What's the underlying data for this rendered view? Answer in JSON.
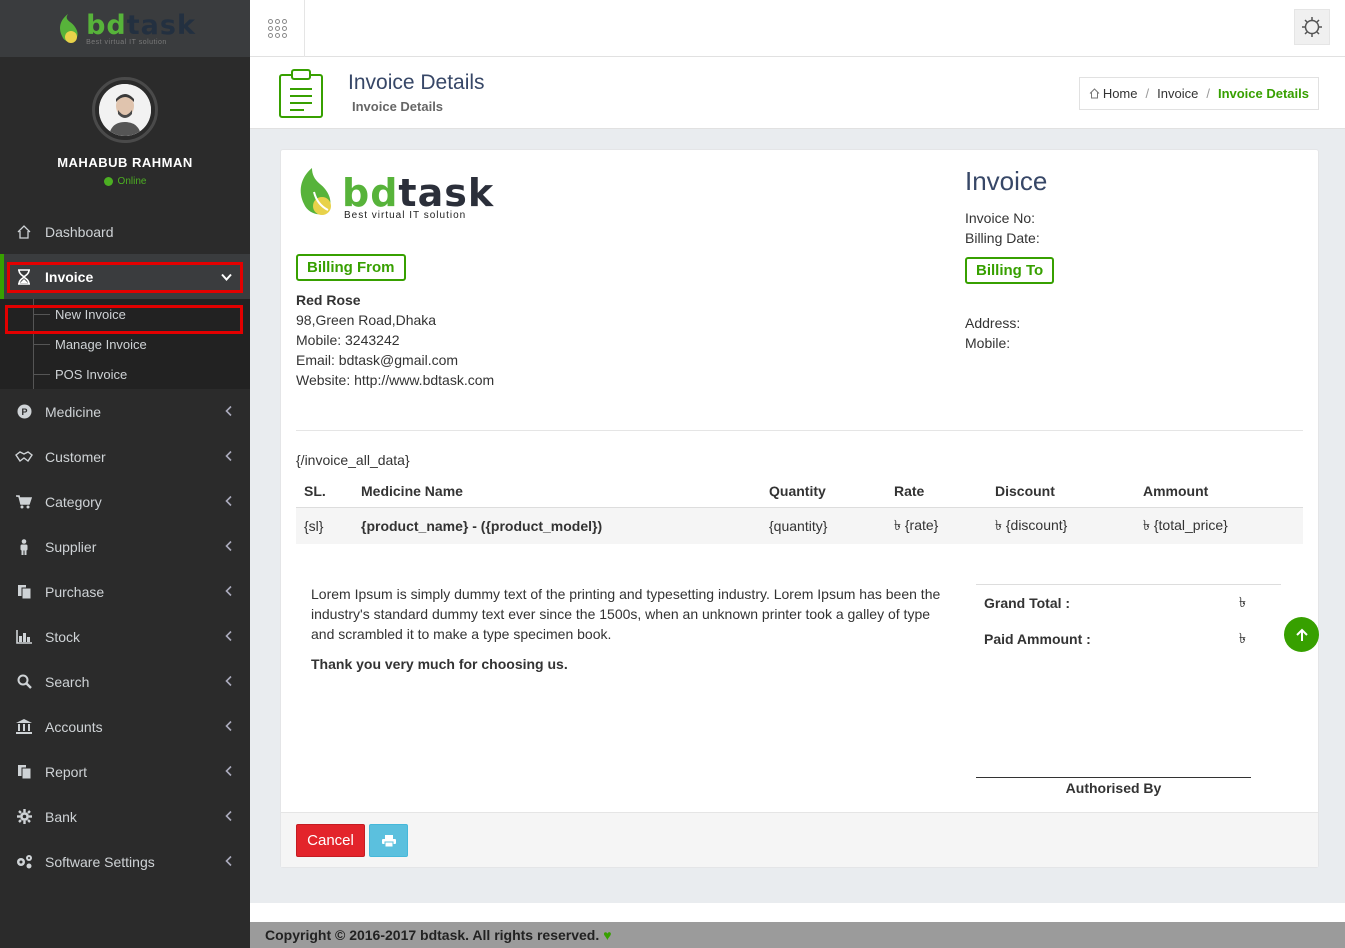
{
  "brand": {
    "part1": "bd",
    "part2": "task",
    "tagline": "Best virtual IT solution"
  },
  "user": {
    "name": "MAHABUB RAHMAN",
    "status": "Online"
  },
  "menu": {
    "dashboard": "Dashboard",
    "invoice": "Invoice",
    "invoice_sub": [
      "New Invoice",
      "Manage Invoice",
      "POS Invoice"
    ],
    "medicine": "Medicine",
    "customer": "Customer",
    "category": "Category",
    "supplier": "Supplier",
    "purchase": "Purchase",
    "stock": "Stock",
    "search": "Search",
    "accounts": "Accounts",
    "report": "Report",
    "bank": "Bank",
    "software_settings": "Software Settings"
  },
  "header": {
    "title": "Invoice Details",
    "subtitle": "Invoice Details"
  },
  "breadcrumb": {
    "home": "Home",
    "invoice": "Invoice",
    "current": "Invoice Details"
  },
  "invoice": {
    "title": "Invoice",
    "no_label": "Invoice No:",
    "date_label": "Billing Date:",
    "billing_from": "Billing From",
    "billing_to": "Billing To",
    "from_name": "Red Rose",
    "from_address": "98,Green Road,Dhaka",
    "from_mobile": "Mobile: 3243242",
    "from_email": "Email: bdtask@gmail.com",
    "from_website": "Website: http://www.bdtask.com",
    "to_address": "Address:",
    "to_mobile": "Mobile:",
    "template_tag": "{/invoice_all_data}"
  },
  "table": {
    "headers": [
      "SL.",
      "Medicine Name",
      "Quantity",
      "Rate",
      "Discount",
      "Ammount"
    ],
    "row": {
      "sl": "{sl}",
      "name": "{product_name} - ({product_model})",
      "qty": "{quantity}",
      "rate": "৳ {rate}",
      "discount": "৳ {discount}",
      "amount": "৳ {total_price}"
    }
  },
  "note": {
    "text": "Lorem Ipsum is simply dummy text of the printing and typesetting industry. Lorem Ipsum has been the industry's standard dummy text ever since the 1500s, when an unknown printer took a galley of type and scrambled it to make a type specimen book.",
    "thanks": "Thank you very much for choosing us."
  },
  "totals": {
    "grand_label": "Grand Total :",
    "grand_value": "৳",
    "paid_label": "Paid Ammount :",
    "paid_value": "৳"
  },
  "signature": "Authorised By",
  "buttons": {
    "cancel": "Cancel"
  },
  "footer": {
    "copyright": "Copyright © 2016-2017 bdtask. All rights reserved."
  },
  "colors": {
    "accent": "#37a000",
    "sidebar": "#2b2b2b",
    "danger": "#e3242b",
    "info": "#5bc0de"
  }
}
